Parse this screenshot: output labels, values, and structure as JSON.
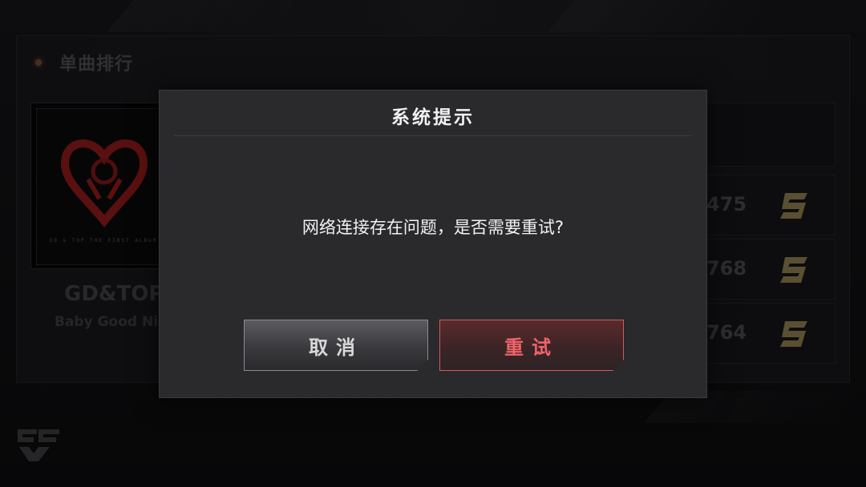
{
  "panel": {
    "title": "单曲排行"
  },
  "album": {
    "tagline": "GD & TOP THE FIRST ALBUM",
    "song_title": "GD&TOP",
    "song_subtitle": "Baby Good Nig"
  },
  "rankings": [
    {
      "score": "475",
      "icon": "s-rank-icon"
    },
    {
      "score": "768",
      "icon": "s-rank-icon"
    },
    {
      "score": "764",
      "icon": "s-rank-icon"
    }
  ],
  "dialog": {
    "title": "系统提示",
    "message": "网络连接存在问题，是否需要重试?",
    "cancel_label": "取消",
    "retry_label": "重试"
  },
  "colors": {
    "accent_red": "#f0646a",
    "dialog_bg": "#2a2a2d",
    "rank_gold": "#8a7a4a"
  }
}
